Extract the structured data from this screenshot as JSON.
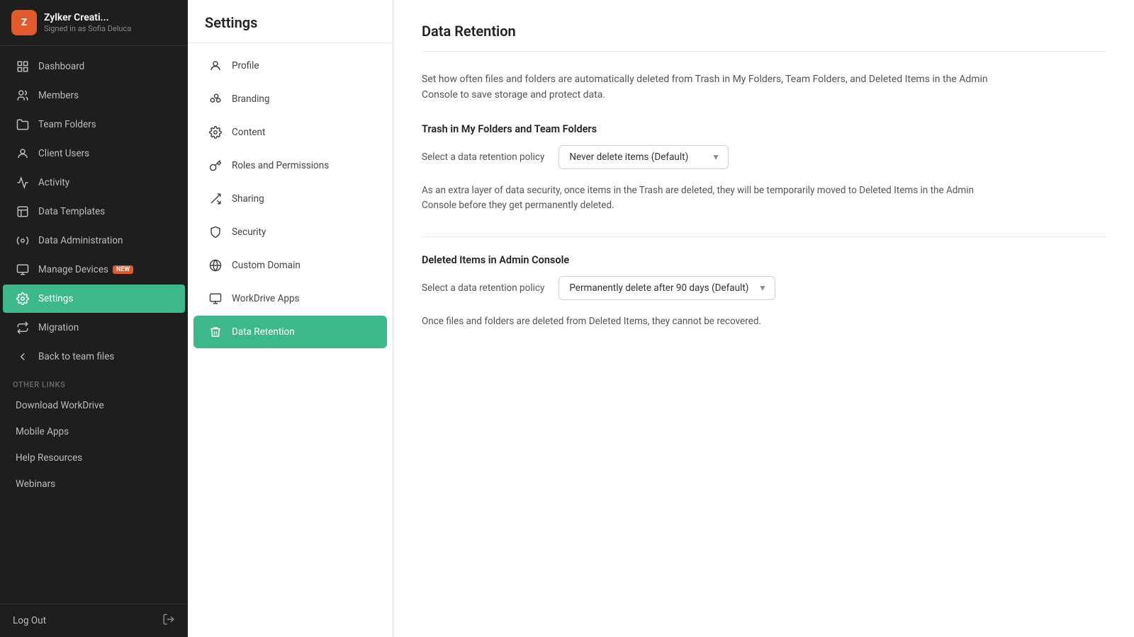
{
  "app": {
    "brand_name": "Zylker Creati...",
    "brand_sub": "Signed in as Sofia Deluca",
    "logo_initials": "Z"
  },
  "sidebar": {
    "items": [
      {
        "id": "dashboard",
        "label": "Dashboard",
        "icon": "⊞"
      },
      {
        "id": "members",
        "label": "Members",
        "icon": "👥"
      },
      {
        "id": "team-folders",
        "label": "Team Folders",
        "icon": "📁"
      },
      {
        "id": "client-users",
        "label": "Client Users",
        "icon": "🧑"
      },
      {
        "id": "activity",
        "label": "Activity",
        "icon": "📊"
      },
      {
        "id": "data-templates",
        "label": "Data Templates",
        "icon": "🗃"
      },
      {
        "id": "data-administration",
        "label": "Data Administration",
        "icon": "⚙"
      },
      {
        "id": "manage-devices",
        "label": "Manage Devices",
        "icon": "💻",
        "badge": "New"
      },
      {
        "id": "settings",
        "label": "Settings",
        "icon": "⚙",
        "active": true
      },
      {
        "id": "migration",
        "label": "Migration",
        "icon": "🔄"
      },
      {
        "id": "back-to-team",
        "label": "Back to team files",
        "icon": "←"
      }
    ],
    "other_links_label": "OTHER LINKS",
    "other_links": [
      {
        "id": "download",
        "label": "Download WorkDrive"
      },
      {
        "id": "mobile-apps",
        "label": "Mobile Apps"
      },
      {
        "id": "help-resources",
        "label": "Help Resources"
      },
      {
        "id": "webinars",
        "label": "Webinars"
      }
    ],
    "footer_logout": "Log Out"
  },
  "settings_panel": {
    "title": "Settings",
    "items": [
      {
        "id": "profile",
        "label": "Profile",
        "icon": "👤"
      },
      {
        "id": "branding",
        "label": "Branding",
        "icon": "🎨"
      },
      {
        "id": "content",
        "label": "Content",
        "icon": "⚙"
      },
      {
        "id": "roles",
        "label": "Roles and Permissions",
        "icon": "🔑"
      },
      {
        "id": "sharing",
        "label": "Sharing",
        "icon": "📤"
      },
      {
        "id": "security",
        "label": "Security",
        "icon": "🛡"
      },
      {
        "id": "custom-domain",
        "label": "Custom Domain",
        "icon": "🌐"
      },
      {
        "id": "workdrive-apps",
        "label": "WorkDrive Apps",
        "icon": "🖥"
      },
      {
        "id": "data-retention",
        "label": "Data Retention",
        "icon": "🗑",
        "active": true
      }
    ]
  },
  "main": {
    "title": "Data Retention",
    "description": "Set how often files and folders are automatically deleted from Trash in My Folders, Team Folders, and Deleted Items in the Admin Console to save storage and protect data.",
    "section1_title": "Trash in My Folders and Team Folders",
    "section1_label": "Select a data retention policy",
    "section1_value": "Never delete items (Default)",
    "section1_note": "As an extra layer of data security, once items in the Trash are deleted, they will be temporarily moved to Deleted Items in the Admin Console before they get permanently deleted.",
    "section2_title": "Deleted Items in Admin Console",
    "section2_label": "Select a data retention policy",
    "section2_value": "Permanently delete after 90 days (Default)",
    "section2_note": "Once files and folders are deleted from Deleted Items, they cannot be recovered."
  },
  "colors": {
    "accent": "#3db88a",
    "brand_orange": "#e05a2b"
  }
}
